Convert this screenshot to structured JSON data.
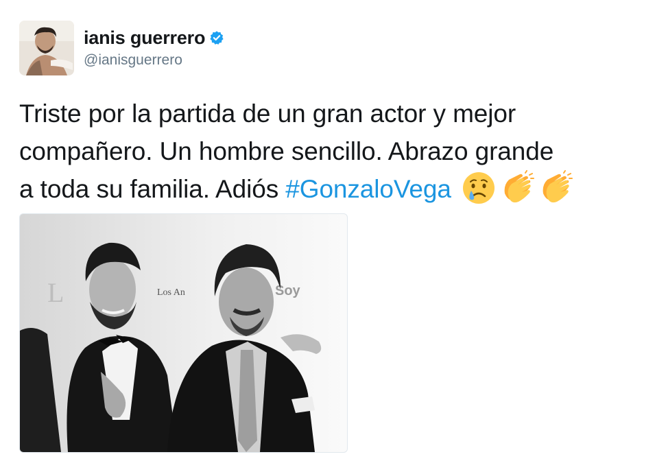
{
  "user": {
    "display_name": "ianis guerrero",
    "handle": "@ianisguerrero",
    "verified": true,
    "verified_color": "#1da1f2"
  },
  "tweet": {
    "text_line1": "Triste por la partida de un gran actor y mejor",
    "text_line2": "compañero. Un hombre sencillo. Abrazo grande",
    "text_line3": "a toda su familia. Adiós ",
    "hashtag": "#GonzaloVega",
    "emojis": [
      "crying-face",
      "clapping-hands",
      "clapping-hands"
    ],
    "hashtag_color": "#1b95e0"
  },
  "media": {
    "type": "photo",
    "style": "black-and-white",
    "background_text_left": "Los An",
    "background_text_right": "Soy"
  }
}
